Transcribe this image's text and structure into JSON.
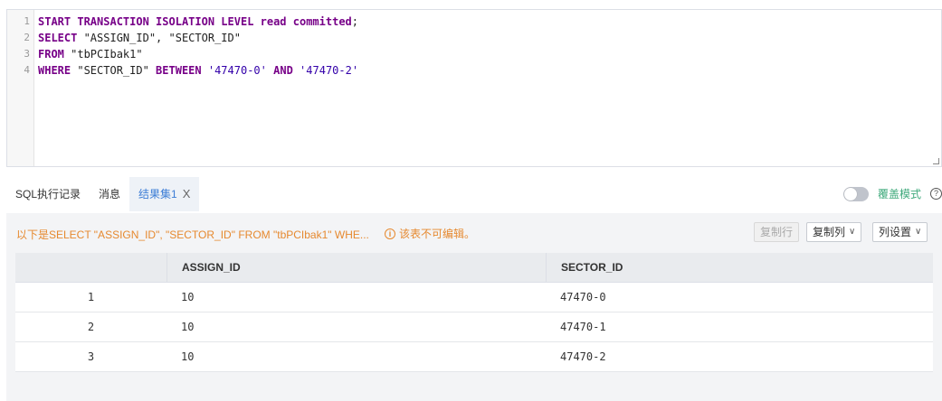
{
  "editor": {
    "line_numbers": [
      "1",
      "2",
      "3",
      "4"
    ],
    "lines": [
      [
        {
          "t": "START TRANSACTION ISOLATION LEVEL read committed",
          "c": "kw"
        },
        {
          "t": ";",
          "c": "id"
        }
      ],
      [
        {
          "t": "SELECT",
          "c": "kw"
        },
        {
          "t": " \"ASSIGN_ID\", \"SECTOR_ID\"",
          "c": "id"
        }
      ],
      [
        {
          "t": "FROM",
          "c": "kw"
        },
        {
          "t": " \"tbPCIbak1\"",
          "c": "id"
        }
      ],
      [
        {
          "t": "WHERE",
          "c": "kw"
        },
        {
          "t": " \"SECTOR_ID\" ",
          "c": "id"
        },
        {
          "t": "BETWEEN",
          "c": "kw"
        },
        {
          "t": " ",
          "c": "id"
        },
        {
          "t": "'47470-0'",
          "c": "str"
        },
        {
          "t": " ",
          "c": "id"
        },
        {
          "t": "AND",
          "c": "kw"
        },
        {
          "t": " ",
          "c": "id"
        },
        {
          "t": "'47470-2'",
          "c": "str"
        }
      ]
    ]
  },
  "tabs": {
    "history": "SQL执行记录",
    "messages": "消息",
    "result": "结果集1",
    "close": "X"
  },
  "overwrite": {
    "label": "覆盖模式",
    "help": "?"
  },
  "result": {
    "info": "以下是SELECT \"ASSIGN_ID\", \"SECTOR_ID\" FROM \"tbPCIbak1\" WHE...",
    "warn_icon": "i",
    "warning": "该表不可编辑。",
    "copy_row": "复制行",
    "copy_col": "复制列",
    "col_settings": "列设置",
    "chevron": "∨",
    "columns": [
      "",
      "ASSIGN_ID",
      "SECTOR_ID"
    ],
    "rows": [
      [
        "1",
        "10",
        "47470-0"
      ],
      [
        "2",
        "10",
        "47470-1"
      ],
      [
        "3",
        "10",
        "47470-2"
      ]
    ]
  },
  "colors": {
    "keyword": "#770088",
    "string": "#3300aa",
    "accent": "#3c7dd6",
    "warning": "#e6892f",
    "toggle_label": "#3ea97b"
  }
}
